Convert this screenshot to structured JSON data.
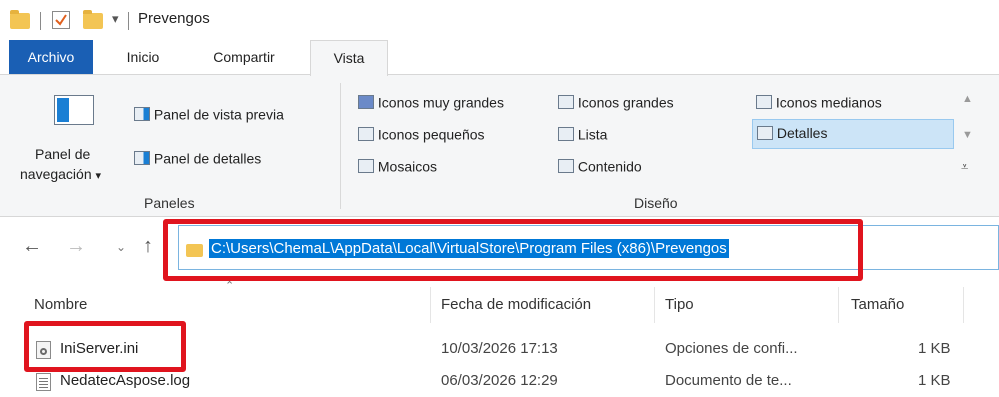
{
  "window": {
    "title": "Prevengos"
  },
  "tabs": [
    {
      "label": "Archivo"
    },
    {
      "label": "Inicio"
    },
    {
      "label": "Compartir"
    },
    {
      "label": "Vista"
    }
  ],
  "ribbon": {
    "panes": {
      "nav_pane_label_line1": "Panel de",
      "nav_pane_label_line2": "navegación",
      "preview_pane": "Panel de vista previa",
      "details_pane": "Panel de detalles",
      "group_label": "Paneles"
    },
    "layout": {
      "extra_large": "Iconos muy grandes",
      "large": "Iconos grandes",
      "medium": "Iconos medianos",
      "small": "Iconos pequeños",
      "list": "Lista",
      "details": "Detalles",
      "tiles": "Mosaicos",
      "content": "Contenido",
      "group_label": "Diseño"
    }
  },
  "address": {
    "path": "C:\\Users\\ChemaL\\AppData\\Local\\VirtualStore\\Program Files (x86)\\Prevengos"
  },
  "columns": {
    "name": "Nombre",
    "modified": "Fecha de modificación",
    "type": "Tipo",
    "size": "Tamaño"
  },
  "files": [
    {
      "name": "IniServer.ini",
      "modified": "10/03/2026 17:13",
      "type": "Opciones de confi...",
      "size": "1 KB"
    },
    {
      "name": "NedatecAspose.log",
      "modified": "06/03/2026 12:29",
      "type": "Documento de te...",
      "size": "1 KB"
    }
  ],
  "colors": {
    "accent": "#1a5fb4",
    "highlight_red": "#e0141e",
    "selection": "#0078d7"
  }
}
